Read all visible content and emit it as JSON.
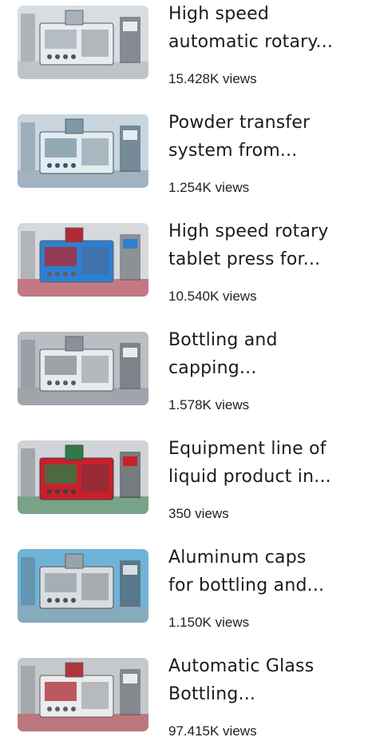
{
  "videos": [
    {
      "title_line1": "High speed",
      "title_line2": "automatic rotary...",
      "views": "15.428K views",
      "thumb_icon": "tablet-press-machine-thumbnail",
      "palette": {
        "bg": "#d9dde1",
        "mid": "#a8b0b8",
        "dark": "#4d5560",
        "accent": "#e9ecef"
      }
    },
    {
      "title_line1": "Powder transfer",
      "title_line2": "system from...",
      "views": "1.254K views",
      "thumb_icon": "powder-transfer-system-thumbnail",
      "palette": {
        "bg": "#c9d6df",
        "mid": "#7f98a8",
        "dark": "#3e5566",
        "accent": "#e3ecf1"
      }
    },
    {
      "title_line1": "High speed rotary",
      "title_line2": "tablet press for...",
      "views": "10.540K views",
      "thumb_icon": "rotary-tablet-press-thumbnail",
      "palette": {
        "bg": "#d7dadd",
        "mid": "#b02a34",
        "dark": "#5b5f66",
        "accent": "#2f7fd0"
      }
    },
    {
      "title_line1": "Bottling and",
      "title_line2": "capping...",
      "views": "1.578K views",
      "thumb_icon": "bottling-capping-machine-thumbnail",
      "palette": {
        "bg": "#b9bec4",
        "mid": "#8a9098",
        "dark": "#555b63",
        "accent": "#e8eaec"
      }
    },
    {
      "title_line1": "Equipment line of",
      "title_line2": "liquid product in...",
      "views": "350 views",
      "thumb_icon": "liquid-product-line-thumbnail",
      "palette": {
        "bg": "#d0d4d8",
        "mid": "#2f7a45",
        "dark": "#3b3f44",
        "accent": "#c8202b"
      }
    },
    {
      "title_line1": "Aluminum caps",
      "title_line2": "for bottling and...",
      "views": "1.150K views",
      "thumb_icon": "aluminum-caps-machine-thumbnail",
      "palette": {
        "bg": "#6fb3d6",
        "mid": "#9aa2aa",
        "dark": "#4a5058",
        "accent": "#d8dde2"
      }
    },
    {
      "title_line1": "Automatic Glass",
      "title_line2": "Bottling...",
      "views": "97.415K views",
      "thumb_icon": "glass-bottling-machine-thumbnail",
      "palette": {
        "bg": "#c6c9cc",
        "mid": "#b0353b",
        "dark": "#5a5e63",
        "accent": "#e9ebed"
      }
    }
  ]
}
